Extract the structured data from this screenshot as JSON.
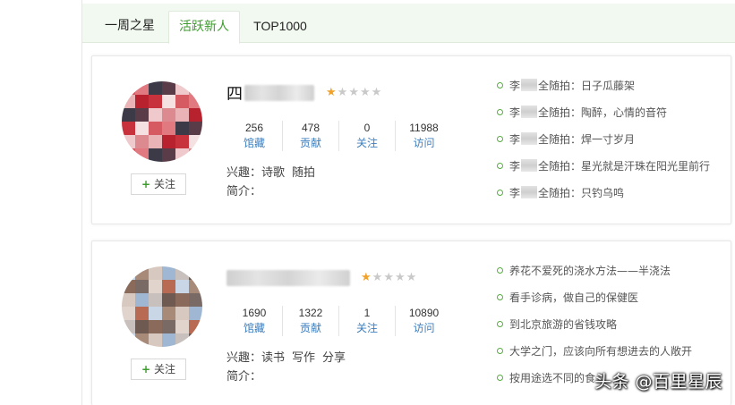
{
  "tabs": [
    {
      "label": "一周之星"
    },
    {
      "label": "活跃新人"
    },
    {
      "label": "TOP1000"
    }
  ],
  "active_tab": "活跃新人",
  "colors": {
    "accent": "#3d9c2e",
    "link": "#3d7fbf",
    "star": "#f0a22b"
  },
  "follow_label": "关注",
  "users": [
    {
      "name_visible": "四",
      "rating": 1,
      "rating_max": 5,
      "stats": [
        {
          "value": "256",
          "label": "馆藏"
        },
        {
          "value": "478",
          "label": "贡献"
        },
        {
          "value": "0",
          "label": "关注"
        },
        {
          "value": "11988",
          "label": "访问"
        }
      ],
      "interests_label": "兴趣：",
      "interests": [
        "诗歌",
        "随拍"
      ],
      "intro_label": "简介：",
      "posts": [
        {
          "prefix": "李",
          "text": "全随拍：日子瓜藤架"
        },
        {
          "prefix": "李",
          "text": "全随拍：陶醉，心情的音符"
        },
        {
          "prefix": "李",
          "text": "全随拍：焊一寸岁月"
        },
        {
          "prefix": "李",
          "text": "全随拍：星光就是汗珠在阳光里前行"
        },
        {
          "prefix": "李",
          "text": "全随拍：只钓乌鸣"
        }
      ]
    },
    {
      "name_visible": "",
      "rating": 1,
      "rating_max": 5,
      "stats": [
        {
          "value": "1690",
          "label": "馆藏"
        },
        {
          "value": "1322",
          "label": "贡献"
        },
        {
          "value": "1",
          "label": "关注"
        },
        {
          "value": "10890",
          "label": "访问"
        }
      ],
      "interests_label": "兴趣：",
      "interests": [
        "读书",
        "写作",
        "分享"
      ],
      "intro_label": "简介：",
      "posts": [
        {
          "prefix": "",
          "text": "养花不爱死的浇水方法——半浇法"
        },
        {
          "prefix": "",
          "text": "看手诊病，做自己的保健医"
        },
        {
          "prefix": "",
          "text": "到北京旅游的省钱攻略"
        },
        {
          "prefix": "",
          "text": "大学之门，应该向所有想进去的人敞开"
        },
        {
          "prefix": "",
          "text": "按用途选不同的食"
        }
      ]
    }
  ],
  "watermark": "头条 @百里星辰"
}
